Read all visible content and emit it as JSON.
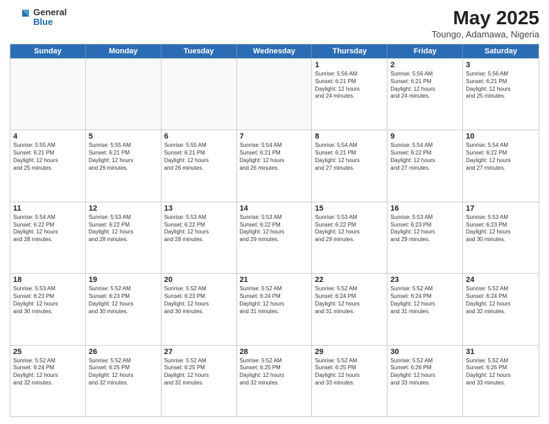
{
  "header": {
    "logo_general": "General",
    "logo_blue": "Blue",
    "month_year": "May 2025",
    "location": "Toungo, Adamawa, Nigeria"
  },
  "weekdays": [
    "Sunday",
    "Monday",
    "Tuesday",
    "Wednesday",
    "Thursday",
    "Friday",
    "Saturday"
  ],
  "rows": [
    [
      {
        "day": "",
        "info": "",
        "empty": true
      },
      {
        "day": "",
        "info": "",
        "empty": true
      },
      {
        "day": "",
        "info": "",
        "empty": true
      },
      {
        "day": "",
        "info": "",
        "empty": true
      },
      {
        "day": "1",
        "info": "Sunrise: 5:56 AM\nSunset: 6:21 PM\nDaylight: 12 hours\nand 24 minutes.",
        "empty": false
      },
      {
        "day": "2",
        "info": "Sunrise: 5:56 AM\nSunset: 6:21 PM\nDaylight: 12 hours\nand 24 minutes.",
        "empty": false
      },
      {
        "day": "3",
        "info": "Sunrise: 5:56 AM\nSunset: 6:21 PM\nDaylight: 12 hours\nand 25 minutes.",
        "empty": false
      }
    ],
    [
      {
        "day": "4",
        "info": "Sunrise: 5:55 AM\nSunset: 6:21 PM\nDaylight: 12 hours\nand 25 minutes.",
        "empty": false
      },
      {
        "day": "5",
        "info": "Sunrise: 5:55 AM\nSunset: 6:21 PM\nDaylight: 12 hours\nand 26 minutes.",
        "empty": false
      },
      {
        "day": "6",
        "info": "Sunrise: 5:55 AM\nSunset: 6:21 PM\nDaylight: 12 hours\nand 26 minutes.",
        "empty": false
      },
      {
        "day": "7",
        "info": "Sunrise: 5:54 AM\nSunset: 6:21 PM\nDaylight: 12 hours\nand 26 minutes.",
        "empty": false
      },
      {
        "day": "8",
        "info": "Sunrise: 5:54 AM\nSunset: 6:21 PM\nDaylight: 12 hours\nand 27 minutes.",
        "empty": false
      },
      {
        "day": "9",
        "info": "Sunrise: 5:54 AM\nSunset: 6:22 PM\nDaylight: 12 hours\nand 27 minutes.",
        "empty": false
      },
      {
        "day": "10",
        "info": "Sunrise: 5:54 AM\nSunset: 6:22 PM\nDaylight: 12 hours\nand 27 minutes.",
        "empty": false
      }
    ],
    [
      {
        "day": "11",
        "info": "Sunrise: 5:54 AM\nSunset: 6:22 PM\nDaylight: 12 hours\nand 28 minutes.",
        "empty": false
      },
      {
        "day": "12",
        "info": "Sunrise: 5:53 AM\nSunset: 6:22 PM\nDaylight: 12 hours\nand 28 minutes.",
        "empty": false
      },
      {
        "day": "13",
        "info": "Sunrise: 5:53 AM\nSunset: 6:22 PM\nDaylight: 12 hours\nand 28 minutes.",
        "empty": false
      },
      {
        "day": "14",
        "info": "Sunrise: 5:53 AM\nSunset: 6:22 PM\nDaylight: 12 hours\nand 29 minutes.",
        "empty": false
      },
      {
        "day": "15",
        "info": "Sunrise: 5:53 AM\nSunset: 6:22 PM\nDaylight: 12 hours\nand 29 minutes.",
        "empty": false
      },
      {
        "day": "16",
        "info": "Sunrise: 5:53 AM\nSunset: 6:23 PM\nDaylight: 12 hours\nand 29 minutes.",
        "empty": false
      },
      {
        "day": "17",
        "info": "Sunrise: 5:53 AM\nSunset: 6:23 PM\nDaylight: 12 hours\nand 30 minutes.",
        "empty": false
      }
    ],
    [
      {
        "day": "18",
        "info": "Sunrise: 5:53 AM\nSunset: 6:23 PM\nDaylight: 12 hours\nand 30 minutes.",
        "empty": false
      },
      {
        "day": "19",
        "info": "Sunrise: 5:52 AM\nSunset: 6:23 PM\nDaylight: 12 hours\nand 30 minutes.",
        "empty": false
      },
      {
        "day": "20",
        "info": "Sunrise: 5:52 AM\nSunset: 6:23 PM\nDaylight: 12 hours\nand 30 minutes.",
        "empty": false
      },
      {
        "day": "21",
        "info": "Sunrise: 5:52 AM\nSunset: 6:24 PM\nDaylight: 12 hours\nand 31 minutes.",
        "empty": false
      },
      {
        "day": "22",
        "info": "Sunrise: 5:52 AM\nSunset: 6:24 PM\nDaylight: 12 hours\nand 31 minutes.",
        "empty": false
      },
      {
        "day": "23",
        "info": "Sunrise: 5:52 AM\nSunset: 6:24 PM\nDaylight: 12 hours\nand 31 minutes.",
        "empty": false
      },
      {
        "day": "24",
        "info": "Sunrise: 5:52 AM\nSunset: 6:24 PM\nDaylight: 12 hours\nand 32 minutes.",
        "empty": false
      }
    ],
    [
      {
        "day": "25",
        "info": "Sunrise: 5:52 AM\nSunset: 6:24 PM\nDaylight: 12 hours\nand 32 minutes.",
        "empty": false
      },
      {
        "day": "26",
        "info": "Sunrise: 5:52 AM\nSunset: 6:25 PM\nDaylight: 12 hours\nand 32 minutes.",
        "empty": false
      },
      {
        "day": "27",
        "info": "Sunrise: 5:52 AM\nSunset: 6:25 PM\nDaylight: 12 hours\nand 32 minutes.",
        "empty": false
      },
      {
        "day": "28",
        "info": "Sunrise: 5:52 AM\nSunset: 6:25 PM\nDaylight: 12 hours\nand 32 minutes.",
        "empty": false
      },
      {
        "day": "29",
        "info": "Sunrise: 5:52 AM\nSunset: 6:25 PM\nDaylight: 12 hours\nand 33 minutes.",
        "empty": false
      },
      {
        "day": "30",
        "info": "Sunrise: 5:52 AM\nSunset: 6:26 PM\nDaylight: 12 hours\nand 33 minutes.",
        "empty": false
      },
      {
        "day": "31",
        "info": "Sunrise: 5:52 AM\nSunset: 6:26 PM\nDaylight: 12 hours\nand 33 minutes.",
        "empty": false
      }
    ]
  ]
}
